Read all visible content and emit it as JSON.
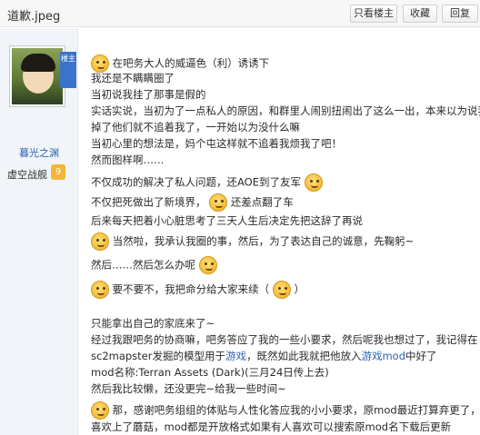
{
  "header": {
    "title": "道歉.jpeg",
    "buttons": {
      "only_op": "只看楼主",
      "favorite": "收藏",
      "reply": "回复"
    }
  },
  "sidebar": {
    "ribbon": "楼主",
    "username": "暮光之渊",
    "tag": "虚空战舰",
    "level": "9"
  },
  "post": {
    "lines": [
      "在吧务大人的威逼色（利）诱诱下",
      "我还是不瞒瞒圈了",
      "当初说我挂了那事是假的",
      "实话实说，当初为了一点私人的原因，和群里人闹别扭闹出了这么一出，本来以为说我挂",
      "掉了他们就不追着我了，一开始以为没什么嘛",
      "当初心里的想法是，妈个屯这样就不追着我烦我了吧！",
      "然而图样啊……",
      "不仅成功的解决了私人问题，还AOE到了友军",
      "不仅把死做出了新境界，",
      "还差点翻了车",
      "后来每天把着小心脏思考了三天人生后决定先把这辞了再说",
      "当然啦，我承认我圈的事，然后，为了表达自己的诚意，先鞠躬~",
      "然后……然后怎么办呢",
      "要不要不，我把命分给大家来续（",
      "）",
      "只能拿出自己的家底来了~",
      "经过我跟吧务的协商嘛，吧务答应了我的一些小要求，然后呢我也想过了，我记得在",
      "sc2mapster发掘的模型用于",
      "游戏",
      "，既然如此我就把他放入",
      "游戏mod",
      "中好了",
      "mod名称:Terran Assets (Dark)(三月24日传上去)",
      "然后我比较懒，还没更完~给我一些时间~",
      "那，感谢吧务组组的体贴与人性化答应我的小小要求，原mod最近打算弃更了，最近",
      "喜欢上了蘑菇，mod都是开放格式如果有人喜欢可以搜索原mod名下载后更新"
    ]
  },
  "icons": [
    "smiley-emoticon-icon"
  ],
  "colors": {
    "link": "#2d64b3",
    "sidebar_bg": "#f1f4f8",
    "level_badge": "#f3b63a"
  }
}
